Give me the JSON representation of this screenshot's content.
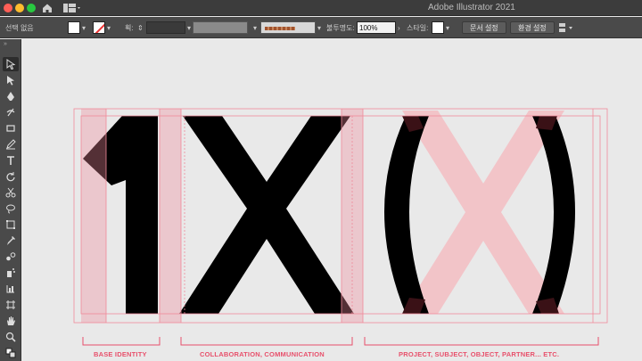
{
  "window": {
    "title": "Adobe Illustrator 2021"
  },
  "controlbar": {
    "selection_label": "선택 없음",
    "stroke_label": "획:",
    "opacity_label": "불투명도:",
    "opacity_value": "100%",
    "style_label": "스타일:",
    "document_setup_button": "문서 설정",
    "preferences_button": "환경 설정"
  },
  "artwork": {
    "glyph_one": "1",
    "glyph_x": "X",
    "glyph_paren_left": "(",
    "glyph_paren_right": ")",
    "accent_color": "#e8506b",
    "guide_color": "#f08a9a",
    "ghost_x_color": "#f2c4c8"
  },
  "labels": {
    "base_identity": "BASE IDENTITY",
    "collaboration": "COLLABORATION, COMMUNICATION",
    "project": "PROJECT, SUBJECT, OBJECT, PARTNER... ETC."
  },
  "colors": {
    "titlebar": "#3c3c3c",
    "panel": "#4a4a4a",
    "canvas": "#e9e9e9"
  }
}
